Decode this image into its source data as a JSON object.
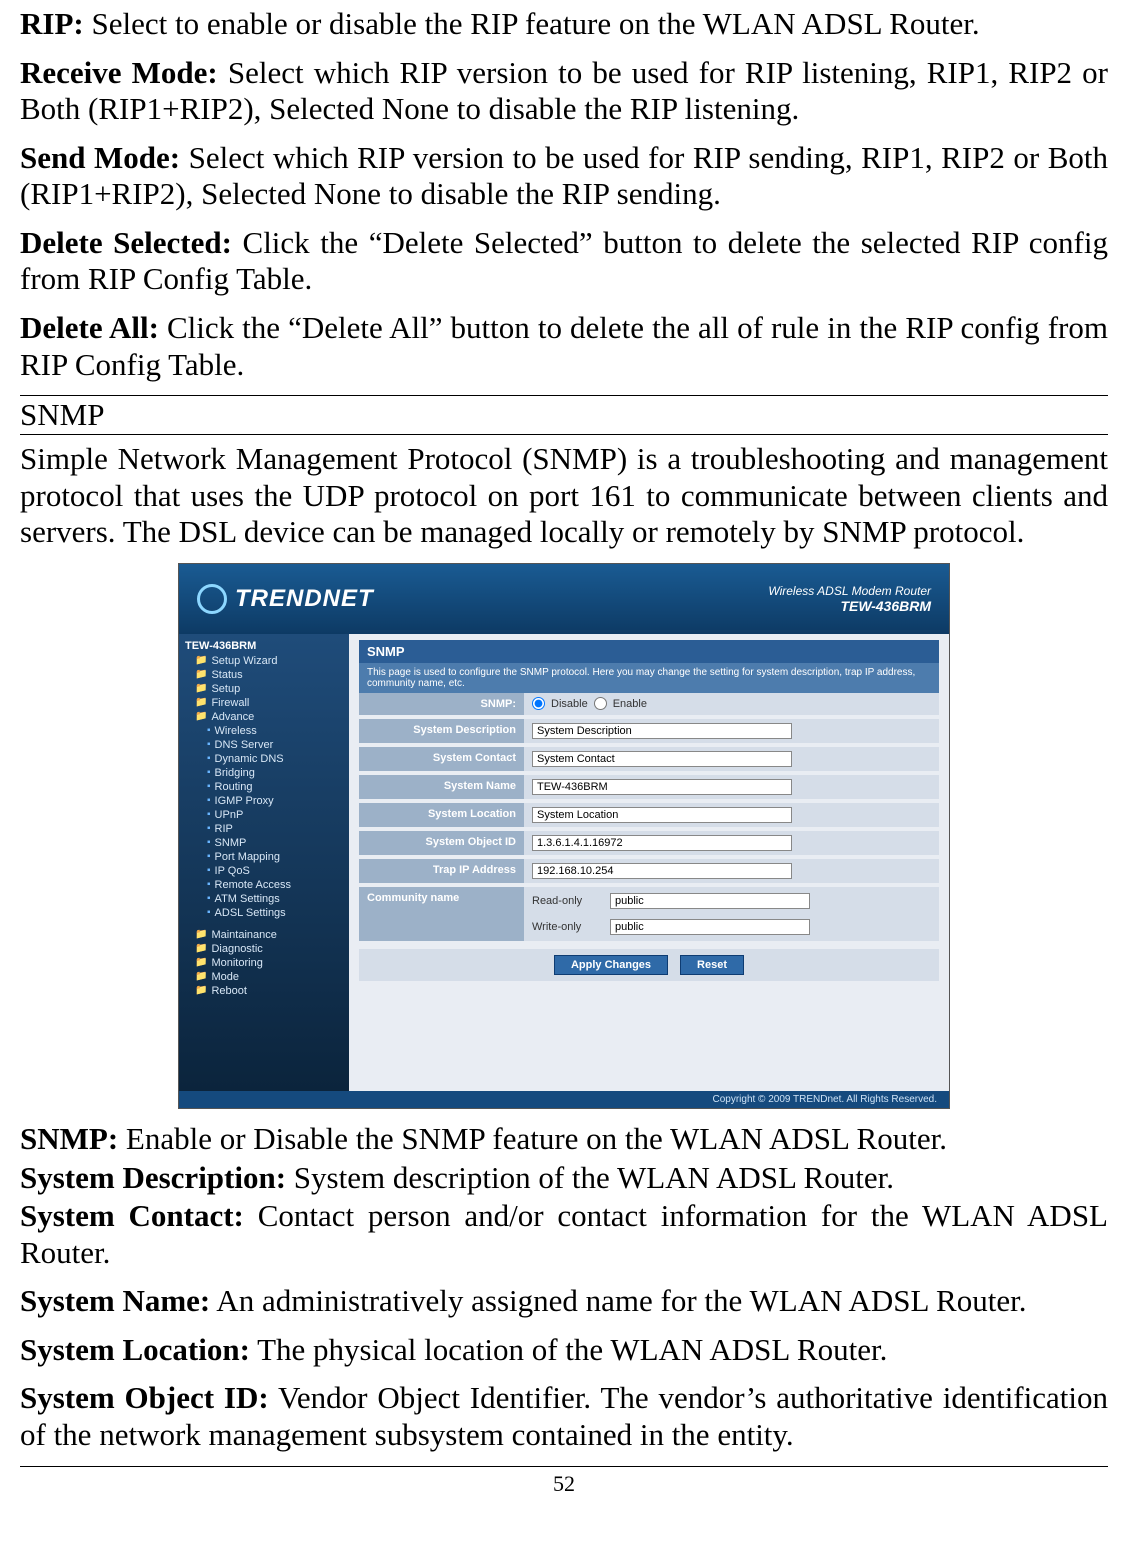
{
  "rip": {
    "rip_label": "RIP:",
    "rip_text": " Select to enable or disable the RIP feature on the WLAN ADSL Router.",
    "recv_label": "Receive Mode:",
    "recv_text": " Select which RIP version to be used for RIP listening, RIP1, RIP2 or Both (RIP1+RIP2), Selected None to disable the RIP listening.",
    "send_label": "Send Mode:",
    "send_text": " Select which RIP version to be used for RIP sending, RIP1, RIP2 or Both (RIP1+RIP2), Selected None to disable the RIP sending.",
    "delsel_label": "Delete Selected:",
    "delsel_text": " Click the “Delete Selected” button to delete the selected RIP config from RIP Config Table.",
    "delall_label": "Delete All:",
    "delall_text": " Click the “Delete All” button to delete the all of rule in the RIP config from RIP Config Table."
  },
  "snmp_heading": "SNMP",
  "snmp_intro": "Simple Network Management Protocol (SNMP) is a troubleshooting and management protocol that uses the UDP protocol on port 161 to communicate between clients and servers. The DSL device can be managed locally or remotely by SNMP protocol.",
  "router_ui": {
    "brand": "TRENDNET",
    "model_line1": "Wireless ADSL Modem Router",
    "model_line2": "TEW-436BRM",
    "sidebar": {
      "root": "TEW-436BRM",
      "folders_top": [
        "Setup Wizard",
        "Status",
        "Setup",
        "Firewall"
      ],
      "folder_open": "Advance",
      "adv_items": [
        "Wireless",
        "DNS Server",
        "Dynamic DNS",
        "Bridging",
        "Routing",
        "IGMP Proxy",
        "UPnP",
        "RIP",
        "SNMP",
        "Port Mapping",
        "IP QoS",
        "Remote Access",
        "ATM Settings",
        "ADSL Settings"
      ],
      "folders_bot": [
        "Maintainance",
        "Diagnostic",
        "Monitoring",
        "Mode",
        "Reboot"
      ]
    },
    "panel": {
      "title": "SNMP",
      "desc": "This page is used to configure the SNMP protocol. Here you may change the setting for system description, trap IP address, community name, etc.",
      "rows": {
        "snmp_label": "SNMP:",
        "snmp_disable": "Disable",
        "snmp_enable": "Enable",
        "sys_desc_label": "System Description",
        "sys_desc_val": "System Description",
        "sys_contact_label": "System Contact",
        "sys_contact_val": "System Contact",
        "sys_name_label": "System Name",
        "sys_name_val": "TEW-436BRM",
        "sys_loc_label": "System Location",
        "sys_loc_val": "System Location",
        "sys_oid_label": "System Object ID",
        "sys_oid_val": "1.3.6.1.4.1.16972",
        "trap_label": "Trap IP Address",
        "trap_val": "192.168.10.254",
        "comm_label": "Community name",
        "ro_label": "Read-only",
        "ro_val": "public",
        "wo_label": "Write-only",
        "wo_val": "public"
      },
      "buttons": {
        "apply": "Apply Changes",
        "reset": "Reset"
      }
    },
    "footer": "Copyright © 2009 TRENDnet. All Rights Reserved."
  },
  "defs": {
    "snmp_label": "SNMP:",
    "snmp_text": " Enable or Disable the SNMP feature on the WLAN ADSL Router.",
    "sysdesc_label": "System Description:",
    "sysdesc_text": " System description of the WLAN ADSL Router.",
    "syscontact_label": "System Contact:",
    "syscontact_text": " Contact person and/or contact information for the WLAN ADSL Router.",
    "sysname_label": "System Name:",
    "sysname_text": " An administratively assigned name for the WLAN ADSL Router.",
    "sysloc_label": "System Location:",
    "sysloc_text": " The physical location of the WLAN ADSL Router.",
    "sysoid_label": "System Object ID:",
    "sysoid_text": " Vendor Object Identifier. The vendor’s authoritative identification of the network management subsystem contained in the entity."
  },
  "page_number": "52"
}
